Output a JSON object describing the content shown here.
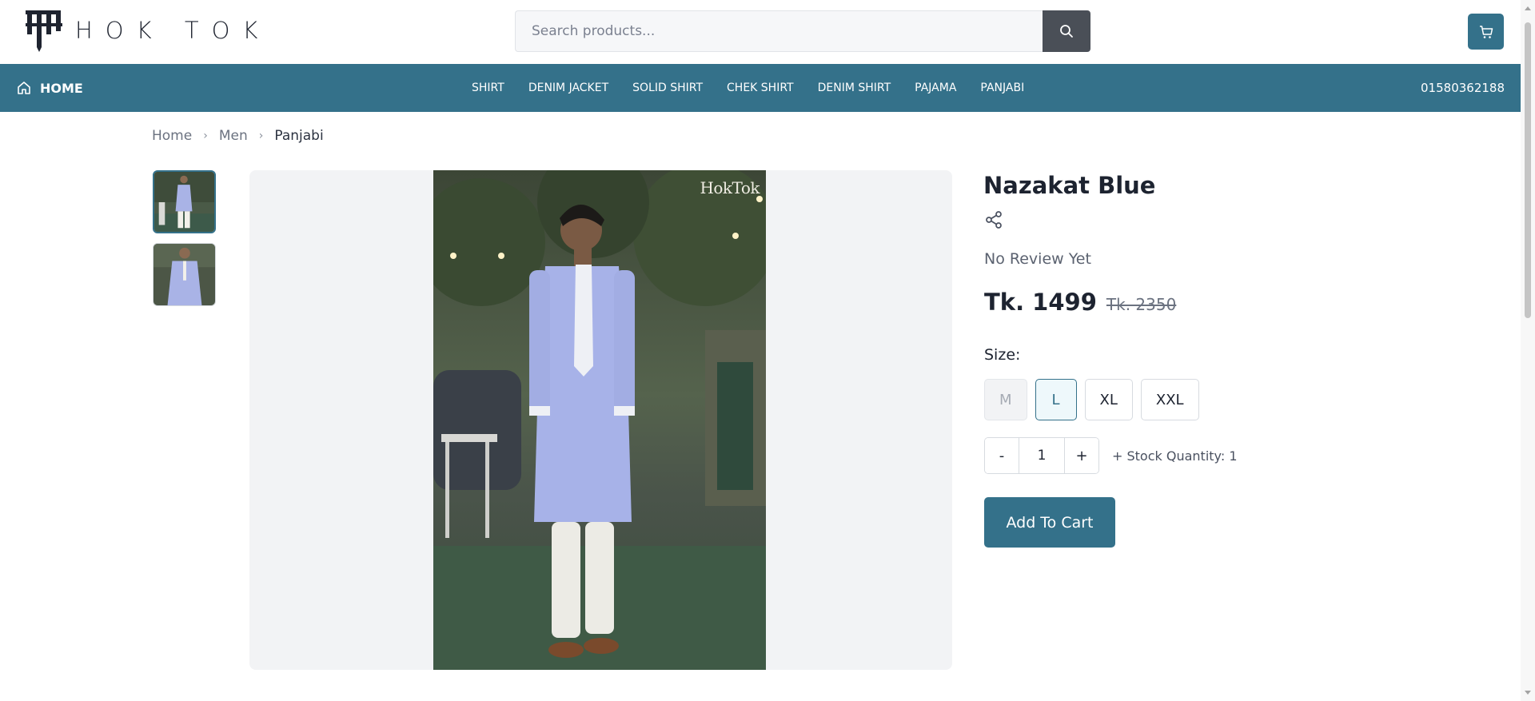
{
  "header": {
    "logo_text": "HOK TOK",
    "search_placeholder": "Search products...",
    "icons": {
      "search": "search-icon",
      "cart": "cart-icon"
    }
  },
  "nav": {
    "home_label": "HOME",
    "links": [
      "SHIRT",
      "DENIM JACKET",
      "SOLID SHIRT",
      "CHEK SHIRT",
      "DENIM SHIRT",
      "PAJAMA",
      "PANJABI"
    ],
    "phone": "01580362188",
    "background": "#34718a"
  },
  "breadcrumb": {
    "items": [
      "Home",
      "Men",
      "Panjabi"
    ]
  },
  "gallery": {
    "watermark": "HokTok",
    "thumbnails": [
      "thumbnail-1",
      "thumbnail-2"
    ],
    "selected_index": 0
  },
  "product": {
    "title": "Nazakat Blue",
    "review_text": "No Review Yet",
    "price": "Tk. 1499",
    "old_price": "Tk. 2350",
    "size_label": "Size:",
    "sizes": [
      {
        "label": "M",
        "state": "disabled"
      },
      {
        "label": "L",
        "state": "selected"
      },
      {
        "label": "XL",
        "state": "available"
      },
      {
        "label": "XXL",
        "state": "available"
      }
    ],
    "quantity": {
      "minus": "-",
      "value": "1",
      "plus": "+",
      "stock_text": "+ Stock Quantity: 1"
    },
    "add_to_cart": "Add To Cart"
  },
  "colors": {
    "accent": "#34718a",
    "text_dark": "#1d2330"
  }
}
